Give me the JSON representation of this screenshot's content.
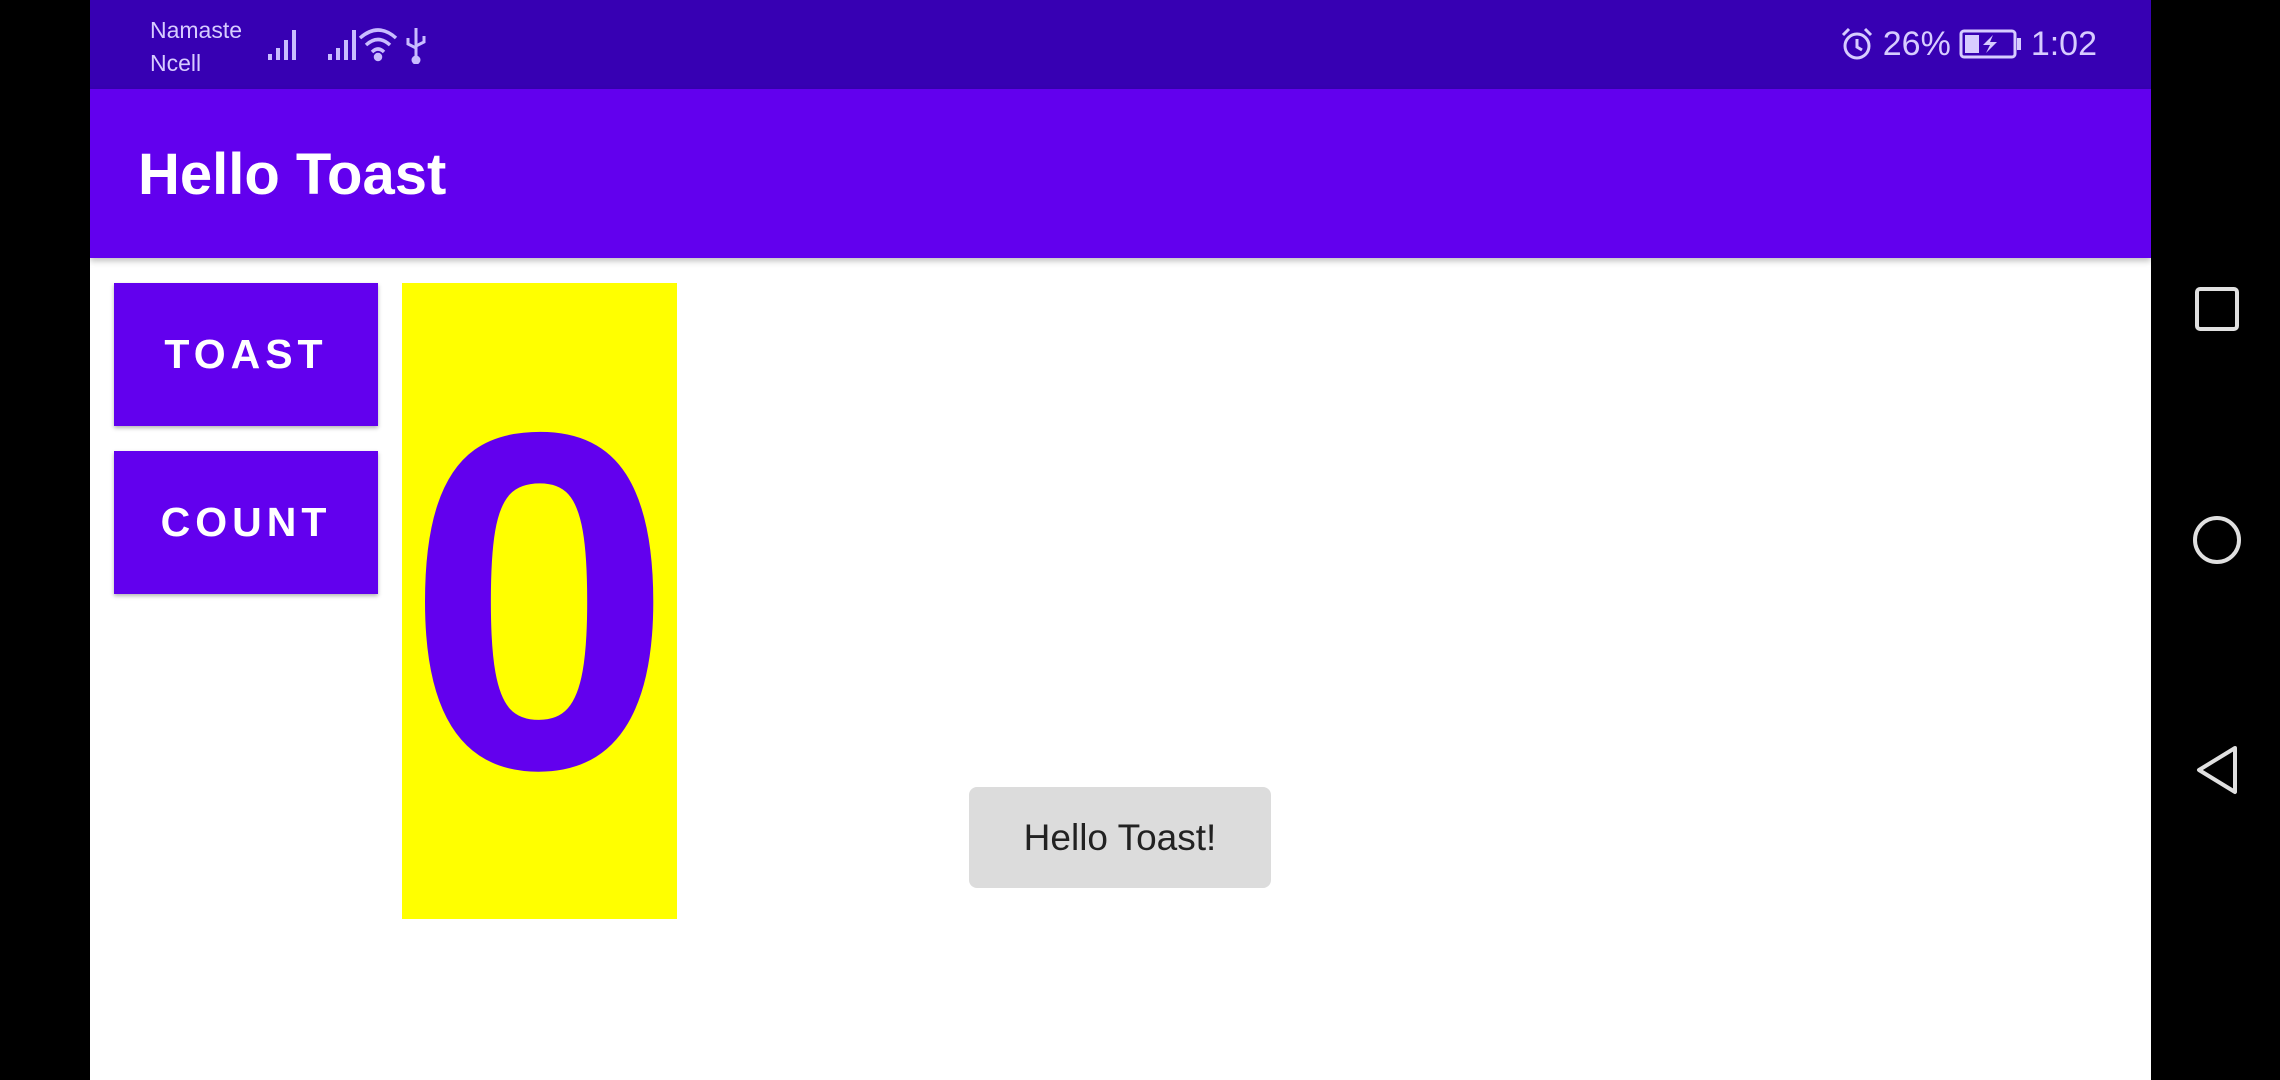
{
  "status_bar": {
    "carrier_line1": "Namaste",
    "carrier_line2": "Ncell",
    "battery_percent": "26%",
    "time": "1:02",
    "icons": [
      "signal-icon",
      "signal-icon",
      "wifi-icon",
      "usb-icon",
      "alarm-icon",
      "battery-charging-icon"
    ]
  },
  "app_bar": {
    "title": "Hello Toast"
  },
  "buttons": {
    "toast_label": "TOAST",
    "count_label": "COUNT"
  },
  "counter": {
    "value": "0"
  },
  "toast": {
    "message": "Hello Toast!"
  },
  "nav_bar": {
    "icons": [
      "recents-icon",
      "home-icon",
      "back-icon"
    ]
  },
  "colors": {
    "primary": "#6200ee",
    "primary_dark": "#3700b3",
    "counter_background": "#ffff00",
    "toast_background": "#dcdcdc"
  }
}
